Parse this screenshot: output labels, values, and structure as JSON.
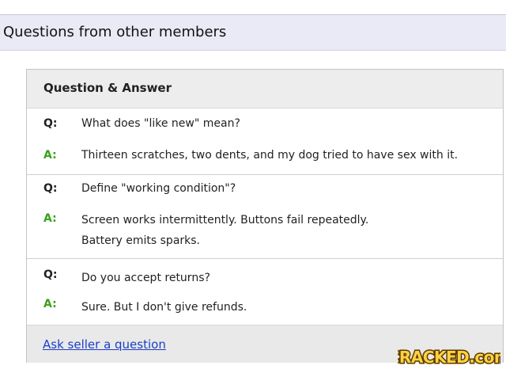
{
  "header": {
    "title": "Questions from other members"
  },
  "panel": {
    "heading": "Question & Answer",
    "qa": [
      {
        "q_marker": "Q:",
        "question": "What does \"like new\" mean?",
        "a_marker": "A:",
        "answer_lines": [
          "Thirteen scratches, two dents, and my dog tried to have sex with it."
        ]
      },
      {
        "q_marker": "Q:",
        "question": "Define \"working condition\"?",
        "a_marker": "A:",
        "answer_lines": [
          "Screen works intermittently. Buttons fail repeatedly.",
          "Battery emits sparks."
        ]
      },
      {
        "q_marker": "Q:",
        "question": "Do you accept returns?",
        "a_marker": "A:",
        "answer_lines": [
          "Sure. But I don't give refunds."
        ]
      }
    ],
    "ask_link": "Ask seller a question"
  },
  "watermark": {
    "text": "CRACKED.com",
    "fill_color": "#ffd23f",
    "stroke_color": "#5a3a00"
  },
  "colors": {
    "header_bg": "#eaeaf6",
    "answer_marker": "#3aa01c",
    "link": "#1a3fc8"
  }
}
